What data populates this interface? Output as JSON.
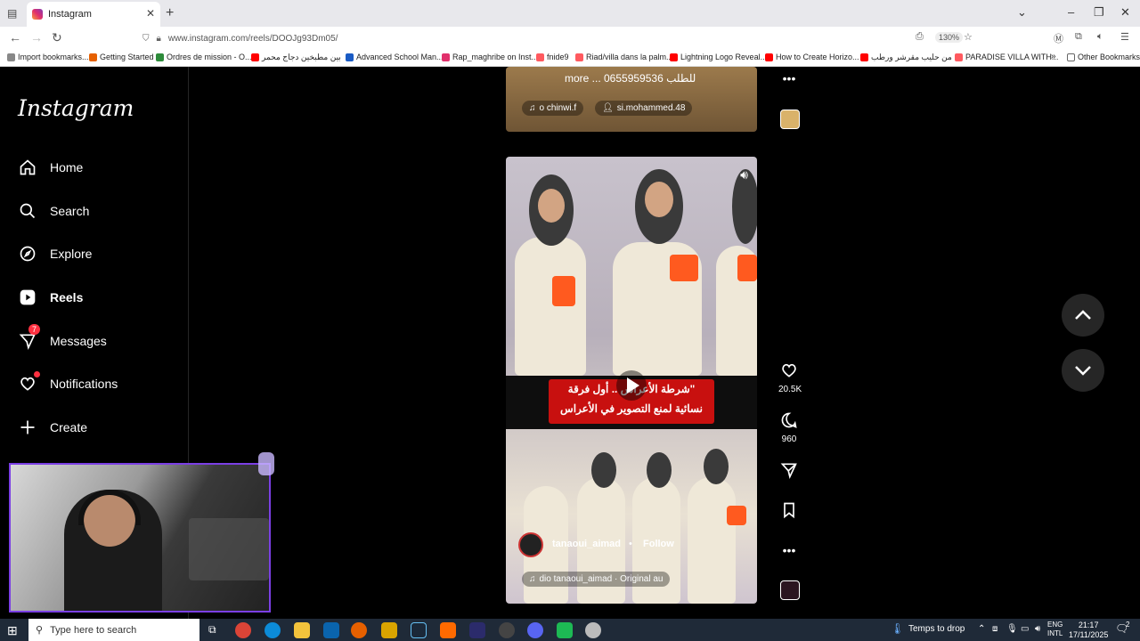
{
  "browser": {
    "tab_title": "Instagram",
    "url": "www.instagram.com/reels/DOOJg93Dm05/",
    "zoom": "130%",
    "bookmarks": [
      "Import bookmarks...",
      "Getting Started",
      "Ordres de mission - O...",
      "بين مطبخين دجاج محمر",
      "Advanced School Man...",
      "Rap_maghribe on Inst...",
      "fnide9",
      "Riad/villa dans la palm...",
      "Lightning Logo Reveal...",
      "How to Create Horizo...",
      "من حليب مقرشر ورطب",
      "PARADISE VILLA WITH...",
      "Other Bookmarks"
    ]
  },
  "sidebar": {
    "logo": "Instagram",
    "items": [
      {
        "label": "Home",
        "icon": "home-icon"
      },
      {
        "label": "Search",
        "icon": "search-icon"
      },
      {
        "label": "Explore",
        "icon": "compass-icon"
      },
      {
        "label": "Reels",
        "icon": "reels-icon"
      },
      {
        "label": "Messages",
        "icon": "messenger-icon",
        "badge": "7"
      },
      {
        "label": "Notifications",
        "icon": "heart-icon"
      },
      {
        "label": "Create",
        "icon": "plus-icon"
      }
    ]
  },
  "reel_top": {
    "caption": "more ... 0655959536 للطلب",
    "audio": "o   chinwi.f",
    "tagged_user": "si.mohammed.48"
  },
  "reel_main": {
    "overlay_text_line1": "\"شرطة الأعراس .. أول فرقة",
    "overlay_text_line2": "نسائية لمنع التصوير في الأعراس",
    "username": "tanaoui_aimad",
    "separator": "•",
    "follow_label": "Follow",
    "audio": "dio     tanaoui_aimad · Original au"
  },
  "actions": {
    "likes": "20.5K",
    "comments": "960"
  },
  "taskbar": {
    "search_placeholder": "Type here to search",
    "weather": "Temps to drop",
    "lang_top": "ENG",
    "lang_bottom": "INTL",
    "time": "21:17",
    "date": "17/11/2025",
    "notif_count": "2"
  },
  "colors": {
    "ig_background": "#000000",
    "badge_red": "#ff3040",
    "caption_red": "#c8100f",
    "armband_orange": "#ff5a1f",
    "webcam_border": "#7b3fe4"
  }
}
